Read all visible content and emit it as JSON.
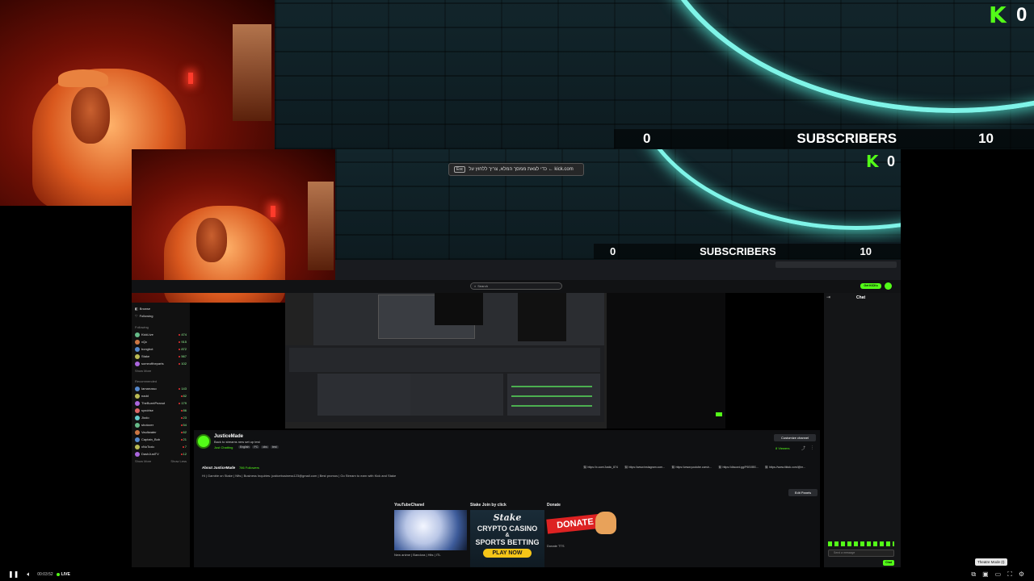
{
  "overlay_top": {
    "min": "0",
    "label": "SUBSCRIBERS",
    "max": "10",
    "count": "0"
  },
  "overlay_inner": {
    "min": "0",
    "label": "SUBSCRIBERS",
    "max": "10",
    "count": "0"
  },
  "kick_logo_glyph": "K",
  "tooltip": {
    "esc": "Esc",
    "text": "כדי לצאת ממסך המלא, צריך ללחוץ על ← kick.com"
  },
  "browser": {
    "search_placeholder": "Search",
    "get_kicks": "Get KICKs",
    "chat_title": "Chat"
  },
  "sidebar": {
    "browse": "Browse",
    "following": "Following",
    "following_header": "Following",
    "following_items": [
      {
        "name": "KickLive",
        "viewers": "474"
      },
      {
        "name": "xQc",
        "viewers": "915"
      },
      {
        "name": "bongbot",
        "viewers": "872"
      },
      {
        "name": "Stake",
        "viewers": "567"
      },
      {
        "name": "someoftheparts",
        "viewers": "102"
      }
    ],
    "show_more": "Show More",
    "recommended_header": "Recommended",
    "recommended_items": [
      {
        "name": "Iamarusso",
        "viewers": "143"
      },
      {
        "name": "nadd",
        "viewers": "82"
      },
      {
        "name": "TheBurntPeanut",
        "viewers": "179"
      },
      {
        "name": "syndrise",
        "viewers": "86"
      },
      {
        "name": "Jiodo",
        "viewers": "23"
      },
      {
        "name": "shotzzer",
        "viewers": "54"
      },
      {
        "name": "Vaultwater",
        "viewers": "62"
      },
      {
        "name": "Captain_Bob",
        "viewers": "21"
      },
      {
        "name": "xNoToxic",
        "viewers": "7"
      },
      {
        "name": "DashJustTV",
        "viewers": "12"
      }
    ],
    "show_more_2": "Show More",
    "show_less": "Show Less"
  },
  "channel": {
    "name": "JusticeMade",
    "title": "Back to streams new set up test",
    "category": "Just Chatting",
    "tags": [
      "English",
      "PC",
      "obs",
      "test"
    ],
    "customize": "Customize channel",
    "viewers": "8 Viewers",
    "about_label": "About JusticeMade",
    "followers": "786 Followers",
    "bio": "Hi | Gamble on Stake | Nfts | Business Inquiries: justicebusiness123@gmail.com | Best promos | Go Stream to earn with Kick and Stake",
    "links": [
      "https://x.com/Justic_874",
      "https://www.instagram.com...",
      "https://www.youtube.com/c...",
      "https://discord.gg/P6SXBS...",
      "https://www.tiktok.com/@m..."
    ],
    "edit_panels": "Edit Panels"
  },
  "panels": [
    {
      "title": "YouTubeChanel",
      "caption": "New anime | Bandora | Hits | ITL"
    },
    {
      "title": "Stake Join by click",
      "line1": "CRYPTO CASINO",
      "line2": "&",
      "line3": "SPORTS BETTING",
      "cta": "PLAY NOW",
      "brand": "Stake"
    },
    {
      "title": "Donate",
      "badge": "DONATE",
      "caption": "Donate TTS"
    }
  ],
  "chat": {
    "send_placeholder": "Send a message",
    "send": "Chat"
  },
  "player": {
    "time": "00:03:52",
    "live": "LIVE",
    "theatre_tooltip": "Theatre Mode (t)"
  },
  "colors": {
    "kick_green": "#53fc18",
    "neon_ring": "#7ff4e8",
    "live_red": "#ff2a2a"
  }
}
